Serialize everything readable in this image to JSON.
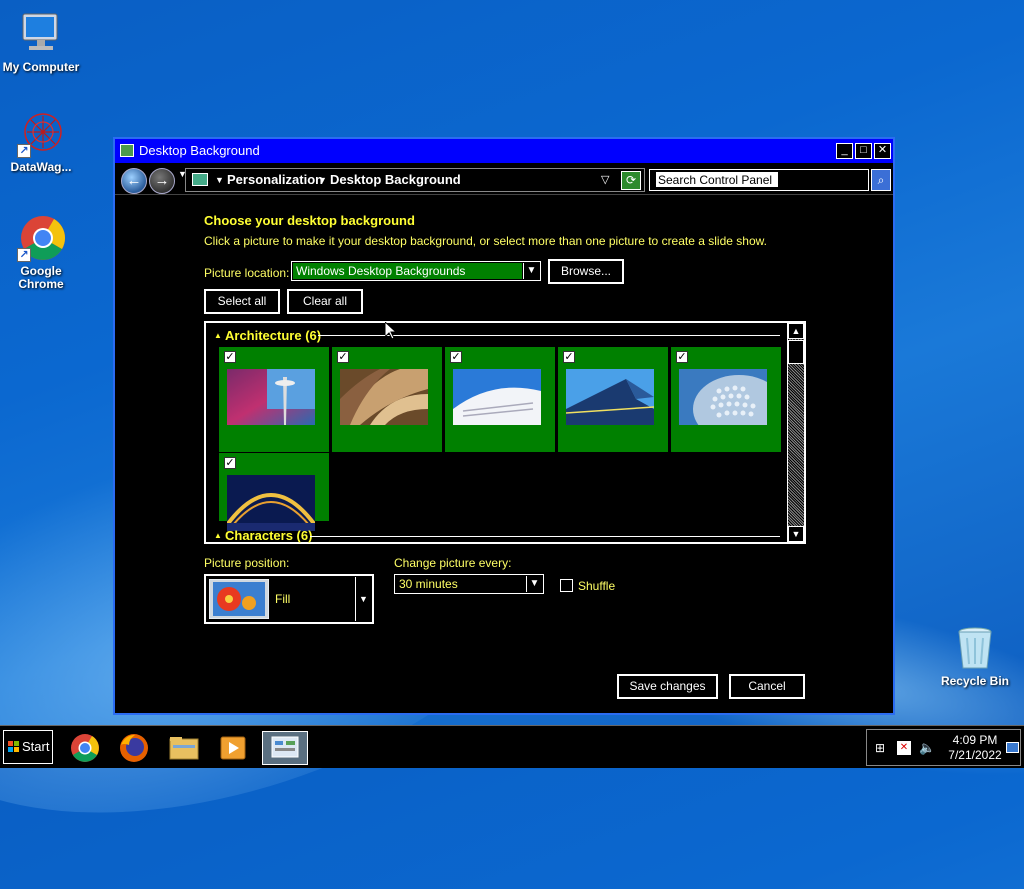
{
  "desktop": {
    "icons": [
      {
        "label": "My Computer"
      },
      {
        "label": "DataWag..."
      },
      {
        "label": "Google Chrome"
      },
      {
        "label": "Recycle Bin"
      }
    ]
  },
  "window": {
    "title": "Desktop Background",
    "breadcrumb": [
      "Personalization",
      "Desktop Background"
    ],
    "search_placeholder": "Search Control Panel",
    "heading": "Choose your desktop background",
    "subtitle": "Click a picture to make it your desktop background, or select more than one picture to create a slide show.",
    "picture_location_label": "Picture location:",
    "picture_location_value": "Windows Desktop Backgrounds",
    "browse_label": "Browse...",
    "select_all_label": "Select all",
    "clear_all_label": "Clear all",
    "groups": [
      {
        "name": "Architecture (6)",
        "tiles": [
          {
            "checked": true,
            "scene": "tower"
          },
          {
            "checked": true,
            "scene": "curves"
          },
          {
            "checked": true,
            "scene": "white-building"
          },
          {
            "checked": true,
            "scene": "blue-facade"
          },
          {
            "checked": true,
            "scene": "dome"
          },
          {
            "checked": true,
            "scene": "night-bridge"
          }
        ]
      },
      {
        "name": "Characters (6)",
        "tiles": []
      }
    ],
    "picture_position_label": "Picture position:",
    "picture_position_value": "Fill",
    "change_picture_label": "Change picture every:",
    "change_picture_value": "30 minutes",
    "shuffle_label": "Shuffle",
    "save_label": "Save changes",
    "cancel_label": "Cancel"
  },
  "taskbar": {
    "start_label": "Start",
    "apps": [
      "chrome",
      "firefox",
      "file-explorer",
      "media-player",
      "control-panel"
    ],
    "clock_time": "4:09 PM",
    "clock_date": "7/21/2022"
  },
  "colors": {
    "selection_green": "#008000",
    "accent_yellow": "#ffff33",
    "title_blue": "#0000ff"
  }
}
